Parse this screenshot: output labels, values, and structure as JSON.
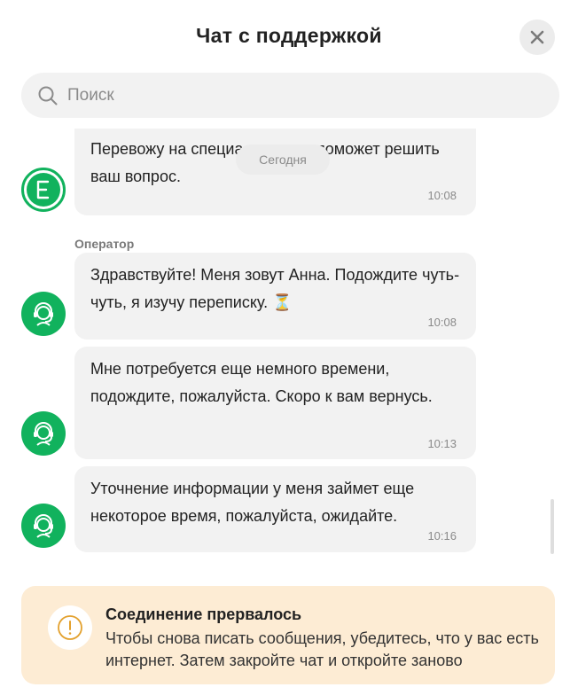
{
  "header": {
    "title": "Чат с поддержкой",
    "close_icon": "close-icon"
  },
  "search": {
    "placeholder": "Поиск"
  },
  "chat": {
    "date_separator": "Сегодня",
    "sender_label": "Оператор",
    "messages": [
      {
        "author": "bot",
        "avatar_icon": "e-logo-icon",
        "text": "Перевожу на специалиста, он поможет решить ваш вопрос.",
        "time": "10:08"
      },
      {
        "author": "operator",
        "avatar_icon": "headset-operator-icon",
        "text": "Здравствуйте! Меня зовут Анна. Подождите чуть-чуть, я изучу переписку.",
        "emoji": "⏳",
        "time": "10:08"
      },
      {
        "author": "operator",
        "avatar_icon": "headset-operator-icon",
        "text": "Мне потребуется еще немного времени, подождите, пожалуйста. Скоро к вам вернусь.",
        "time": "10:13"
      },
      {
        "author": "operator",
        "avatar_icon": "headset-operator-icon",
        "text": "Уточнение информации у меня займет еще некоторое время, пожалуйста, ожидайте.",
        "time": "10:16"
      }
    ]
  },
  "notice": {
    "icon": "warning-icon",
    "title": "Соединение прервалось",
    "text": "Чтобы снова писать сообщения, убедитесь, что у вас есть интернет. Затем закройте чат и откройте заново"
  },
  "colors": {
    "accent": "#11b25d",
    "bubble": "#f2f2f2",
    "notice_bg": "#fdecd4",
    "warning": "#e3a12e"
  }
}
